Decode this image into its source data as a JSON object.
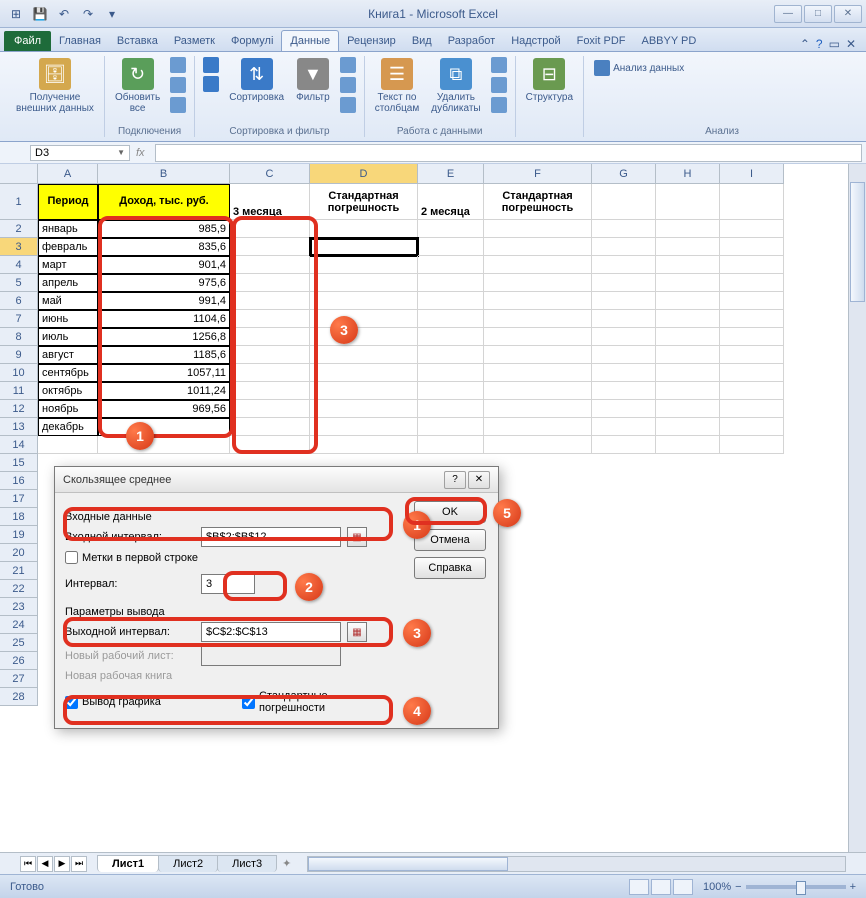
{
  "title": "Книга1 - Microsoft Excel",
  "ribbon": {
    "file": "Файл",
    "tabs": [
      "Главная",
      "Вставка",
      "Разметк",
      "Формулі",
      "Данные",
      "Рецензир",
      "Вид",
      "Разработ",
      "Надстрой",
      "Foxit PDF",
      "ABBYY PD"
    ],
    "active_tab": "Данные",
    "groups": {
      "g1": {
        "label": "",
        "btn1": "Получение\nвнешних данных"
      },
      "g2": {
        "label": "Подключения",
        "btn1": "Обновить\nвсе"
      },
      "g3": {
        "label": "Сортировка и фильтр",
        "btn1": "Сортировка",
        "btn2": "Фильтр"
      },
      "g4": {
        "label": "Работа с данными",
        "btn1": "Текст по\nстолбцам",
        "btn2": "Удалить\nдубликаты"
      },
      "g5": {
        "label": "",
        "btn1": "Структура"
      },
      "g6": {
        "label": "Анализ",
        "btn1": "Анализ данных"
      }
    }
  },
  "namebox": "D3",
  "columns": [
    "A",
    "B",
    "C",
    "D",
    "E",
    "F",
    "G",
    "H",
    "I"
  ],
  "headers": {
    "A": "Период",
    "B": "Доход, тыс. руб.",
    "C": "3 месяца",
    "D": "Стандартная погрешность",
    "E": "2 месяца",
    "F": "Стандартная погрешность"
  },
  "rows": [
    {
      "n": 2,
      "A": "январь",
      "B": "985,9"
    },
    {
      "n": 3,
      "A": "февраль",
      "B": "835,6"
    },
    {
      "n": 4,
      "A": "март",
      "B": "901,4"
    },
    {
      "n": 5,
      "A": "апрель",
      "B": "975,6"
    },
    {
      "n": 6,
      "A": "май",
      "B": "991,4"
    },
    {
      "n": 7,
      "A": "июнь",
      "B": "1104,6"
    },
    {
      "n": 8,
      "A": "июль",
      "B": "1256,8"
    },
    {
      "n": 9,
      "A": "август",
      "B": "1185,6"
    },
    {
      "n": 10,
      "A": "сентябрь",
      "B": "1057,11"
    },
    {
      "n": 11,
      "A": "октябрь",
      "B": "1011,24"
    },
    {
      "n": 12,
      "A": "ноябрь",
      "B": "969,56"
    },
    {
      "n": 13,
      "A": "декабрь",
      "B": ""
    }
  ],
  "dialog": {
    "title": "Скользящее среднее",
    "sec_input": "Входные данные",
    "lbl_input_range": "Входной интервал:",
    "val_input_range": "$B$2:$B$12",
    "chk_labels": "Метки в первой строке",
    "lbl_interval": "Интервал:",
    "val_interval": "3",
    "sec_output": "Параметры вывода",
    "lbl_output_range": "Выходной интервал:",
    "val_output_range": "$C$2:$C$13",
    "lbl_new_sheet": "Новый рабочий лист:",
    "lbl_new_book": "Новая рабочая книга",
    "chk_chart": "Вывод графика",
    "chk_stderr": "Стандартные погрешности",
    "btn_ok": "OK",
    "btn_cancel": "Отмена",
    "btn_help": "Справка"
  },
  "sheets": [
    "Лист1",
    "Лист2",
    "Лист3"
  ],
  "status": {
    "ready": "Готово",
    "zoom": "100%"
  }
}
